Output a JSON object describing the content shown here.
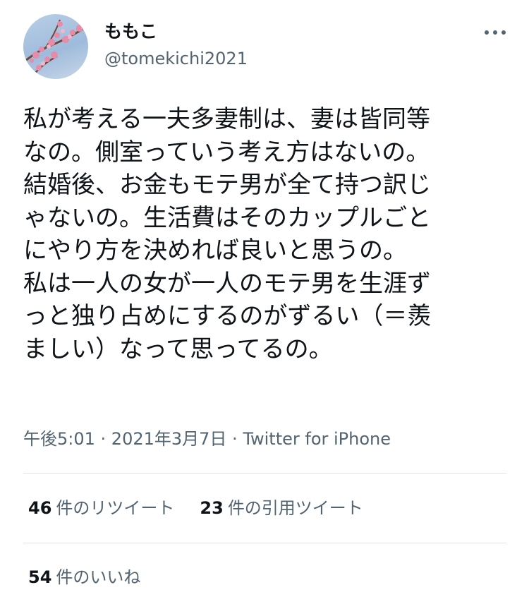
{
  "user": {
    "display_name": "ももこ",
    "handle": "@tomekichi2021"
  },
  "tweet": {
    "lines": [
      "私が考える一夫多妻制は、妻は皆同等",
      "なの。側室っていう考え方はないの。",
      "結婚後、お金もモテ男が全て持つ訳じ",
      "ゃないの。生活費はそのカップルごと",
      "にやり方を決めれば良いと思うの。",
      "私は一人の女が一人のモテ男を生涯ず",
      "っと独り占めにするのがずるい（＝羨",
      "ましい）なって思ってるの。"
    ],
    "time": "午後5:01",
    "sep1": " · ",
    "date": "2021年3月7日",
    "sep2": " · ",
    "source": "Twitter for iPhone"
  },
  "stats": {
    "retweets_count": "46",
    "retweets_label": "件のリツイート",
    "quotes_count": "23",
    "quotes_label": "件の引用ツイート",
    "likes_count": "54",
    "likes_label": "件のいいね"
  },
  "colors": {
    "text": "#0f1419",
    "secondary": "#536471",
    "divider": "#dfe3e7"
  }
}
